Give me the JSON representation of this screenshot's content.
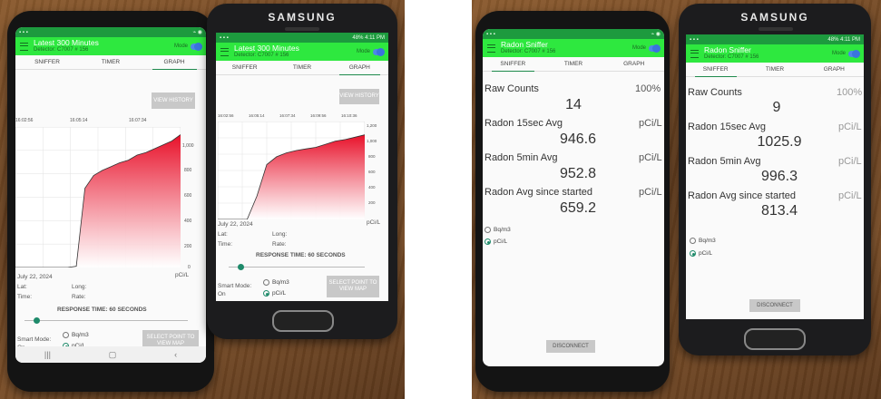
{
  "brand": "SAMSUNG",
  "graph_screen": {
    "title": "Latest 300 Minutes",
    "subtitle": "Detector: C7007 # 156",
    "mode_label": "Mode",
    "status_time": "4:11 PM",
    "status_battery": "48%",
    "tabs": [
      "SNIFFER",
      "TIMER",
      "GRAPH"
    ],
    "view_history": "VIEW HISTORY",
    "time_ticks_a": [
      "16:02:56",
      "16:05:14",
      "16:07:34"
    ],
    "time_ticks_b": [
      "16:02:56",
      "16:05:14",
      "16:07:34",
      "16:09:56",
      "16:10:36"
    ],
    "y_ticks_a": [
      "1,000",
      "800",
      "600",
      "400",
      "200",
      "0"
    ],
    "y_ticks_b": [
      "1,200",
      "1,000",
      "800",
      "600",
      "400",
      "200"
    ],
    "date": "July 22, 2024",
    "unit": "pCi/L",
    "lat_label": "Lat:",
    "long_label": "Long:",
    "time_label": "Time:",
    "rate_label": "Rate:",
    "response_time": "RESPONSE TIME: 60 SECONDS",
    "smart_mode": "Smart Mode:",
    "smart_mode_value": "On",
    "unit_options": [
      "Bq/m3",
      "pCi/L"
    ],
    "map_button": "SELECT POINT TO VIEW MAP"
  },
  "sniffer_screen": {
    "title": "Radon Sniffer",
    "subtitle": "Detector: C7007 # 156",
    "mode_label": "Mode",
    "status_time": "4:11 PM",
    "status_battery": "48%",
    "tabs": [
      "SNIFFER",
      "TIMER",
      "GRAPH"
    ],
    "raw_counts_label": "Raw Counts",
    "percent": "100%",
    "labels": {
      "avg15": "Radon 15sec Avg",
      "avg5min": "Radon 5min Avg",
      "avg_since": "Radon Avg since started",
      "unit": "pCi/L"
    },
    "phone_a": {
      "raw": "14",
      "avg15": "946.6",
      "avg5min": "952.8",
      "avg_since": "659.2"
    },
    "phone_b": {
      "raw": "9",
      "avg15": "1025.9",
      "avg5min": "996.3",
      "avg_since": "813.4"
    },
    "unit_options": [
      "Bq/m3",
      "pCi/L"
    ],
    "disconnect": "DISCONNECT"
  },
  "colors": {
    "appbar": "#2ee83f",
    "chart_top": "#e8112a",
    "chart_bottom": "#ffffff",
    "accent": "#1e8a6a"
  },
  "chart_data": [
    {
      "type": "area",
      "x": [
        "16:02:56",
        "16:05:14",
        "16:07:34"
      ],
      "values": [
        0,
        0,
        0,
        0,
        0,
        0,
        0,
        10,
        620,
        720,
        760,
        790,
        820,
        840,
        880,
        900,
        930,
        960,
        990,
        1040
      ],
      "ylim": [
        0,
        1100
      ],
      "grid": true
    },
    {
      "type": "area",
      "x": [
        "16:02:56",
        "16:05:14",
        "16:07:34",
        "16:09:56",
        "16:10:36"
      ],
      "values": [
        0,
        0,
        0,
        0,
        300,
        700,
        800,
        850,
        880,
        900,
        920,
        960,
        1000,
        1020,
        1050,
        1080
      ],
      "ylim": [
        0,
        1250
      ],
      "grid": true
    }
  ]
}
